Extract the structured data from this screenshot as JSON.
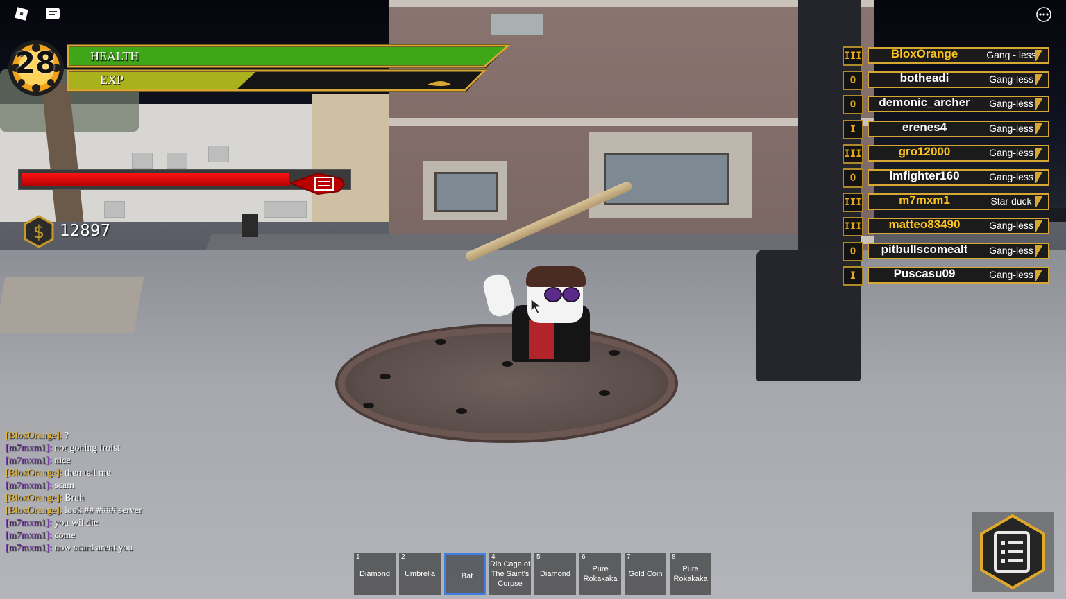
{
  "hud": {
    "level": "28",
    "health_label": "HEALTH",
    "exp_label": "EXP",
    "health_fraction": 1.0,
    "exp_fraction": 0.45,
    "target_health_fraction": 0.82,
    "money": "12897"
  },
  "colors": {
    "health": "#3fa61a",
    "exp": "#a9b21c",
    "gold": "#d8a732",
    "target_bar": "#ff1414",
    "selected_slot": "#3f7fe0"
  },
  "players": [
    {
      "rank": "III",
      "name": "BloxOrange",
      "gang": "Gang - less",
      "highlight": true
    },
    {
      "rank": "O",
      "name": "botheadi",
      "gang": "Gang-less"
    },
    {
      "rank": "O",
      "name": "demonic_archer",
      "gang": "Gang-less"
    },
    {
      "rank": "I",
      "name": "erenes4",
      "gang": "Gang-less"
    },
    {
      "rank": "III",
      "name": "gro12000",
      "gang": "Gang-less",
      "highlight": true
    },
    {
      "rank": "O",
      "name": "lmfighter160",
      "gang": "Gang-less"
    },
    {
      "rank": "III",
      "name": "m7mxm1",
      "gang": "Star duck",
      "highlight": true
    },
    {
      "rank": "III",
      "name": "matteo83490",
      "gang": "Gang-less",
      "highlight": true
    },
    {
      "rank": "O",
      "name": "pitbullscomealt",
      "gang": "Gang-less"
    },
    {
      "rank": "I",
      "name": "Puscasu09",
      "gang": "Gang-less"
    }
  ],
  "chat": [
    {
      "name": "[BloxOrange]:",
      "color": "#e8b42a",
      "text": "?"
    },
    {
      "name": "[m7mxm1]:",
      "color": "#7a3fa6",
      "text": "nor goning froist"
    },
    {
      "name": "[m7mxm1]:",
      "color": "#7a3fa6",
      "text": "nice"
    },
    {
      "name": "[BloxOrange]:",
      "color": "#e8b42a",
      "text": "then tell me"
    },
    {
      "name": "[m7mxm1]:",
      "color": "#7a3fa6",
      "text": "scam"
    },
    {
      "name": "[BloxOrange]:",
      "color": "#e8b42a",
      "text": "Bruh"
    },
    {
      "name": "[BloxOrange]:",
      "color": "#e8b42a",
      "text": "look ## #### server"
    },
    {
      "name": "[m7mxm1]:",
      "color": "#7a3fa6",
      "text": "you wil die"
    },
    {
      "name": "[m7mxm1]:",
      "color": "#7a3fa6",
      "text": "come"
    },
    {
      "name": "[m7mxm1]:",
      "color": "#7a3fa6",
      "text": "now scard arent you"
    }
  ],
  "hotbar": [
    {
      "num": "1",
      "name": "Diamond"
    },
    {
      "num": "2",
      "name": "Umbrella"
    },
    {
      "num": "",
      "name": "Bat",
      "selected": true
    },
    {
      "num": "4",
      "name": "Rib Cage of The Saint's Corpse"
    },
    {
      "num": "5",
      "name": "Diamond"
    },
    {
      "num": "6",
      "name": "Pure Rokakaka"
    },
    {
      "num": "7",
      "name": "Gold Coin"
    },
    {
      "num": "8",
      "name": "Pure Rokakaka"
    }
  ],
  "icons": {
    "roblox": "roblox-logo-icon",
    "chat": "chat-icon",
    "more": "more-options-icon",
    "money": "dollar-icon",
    "quest": "checklist-icon",
    "target": "target-emblem-icon"
  }
}
